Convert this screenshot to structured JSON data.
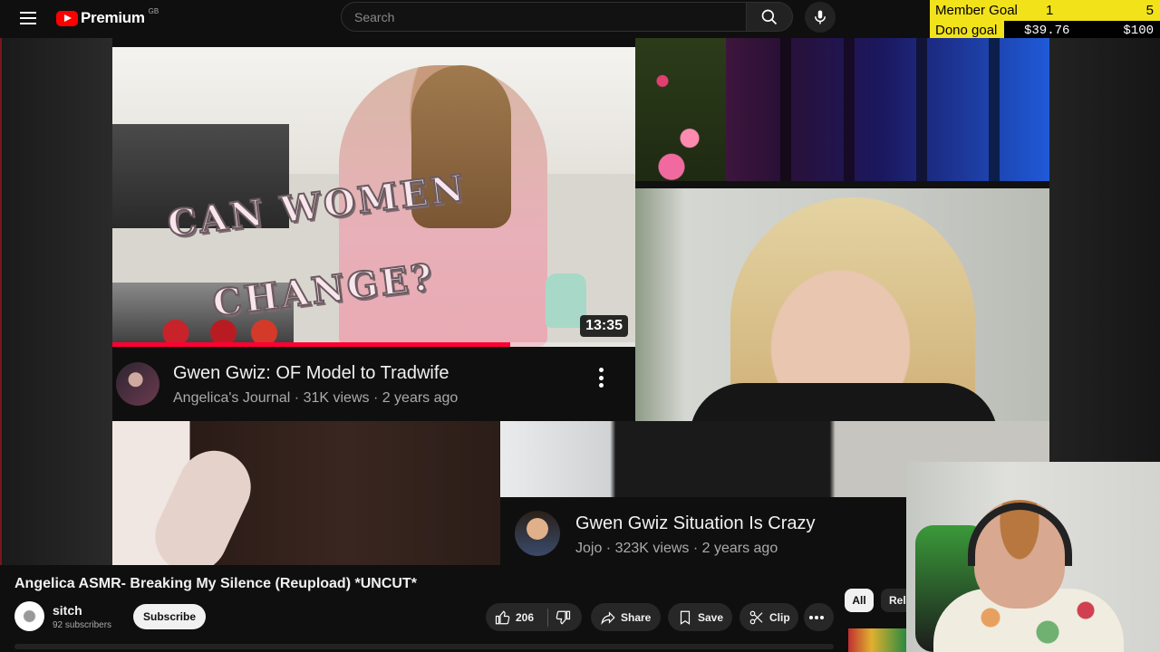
{
  "header": {
    "logo_text": "Premium",
    "region": "GB",
    "search_placeholder": "Search"
  },
  "goals": {
    "member_label": "Member Goal",
    "member_current": "1",
    "member_target": "5",
    "dono_label": "Dono goal",
    "dono_current": "$39.76",
    "dono_target": "$100"
  },
  "video1": {
    "overlay_line1": "CAN WOMEN",
    "overlay_line2": "CHANGE?",
    "duration": "13:35",
    "watched_fraction": 0.76,
    "title": "Gwen Gwiz: OF Model to Tradwife",
    "meta": "Angelica's Journal · 31K views · 2 years ago"
  },
  "video2": {
    "title": "Gwen Gwiz Situation Is Crazy",
    "meta": "Jojo · 323K views · 2 years ago"
  },
  "page": {
    "title": "Angelica ASMR- Breaking My Silence (Reupload) *UNCUT*",
    "channel_name": "sitch",
    "channel_subs": "92 subscribers",
    "subscribe_label": "Subscribe",
    "likes": "206",
    "share_label": "Share",
    "save_label": "Save",
    "clip_label": "Clip"
  },
  "chips": {
    "all": "All",
    "related": "Rel"
  },
  "colors": {
    "brand_red": "#ff0000",
    "progress_red": "#ff0033",
    "goal_yellow": "#f2e21a"
  }
}
